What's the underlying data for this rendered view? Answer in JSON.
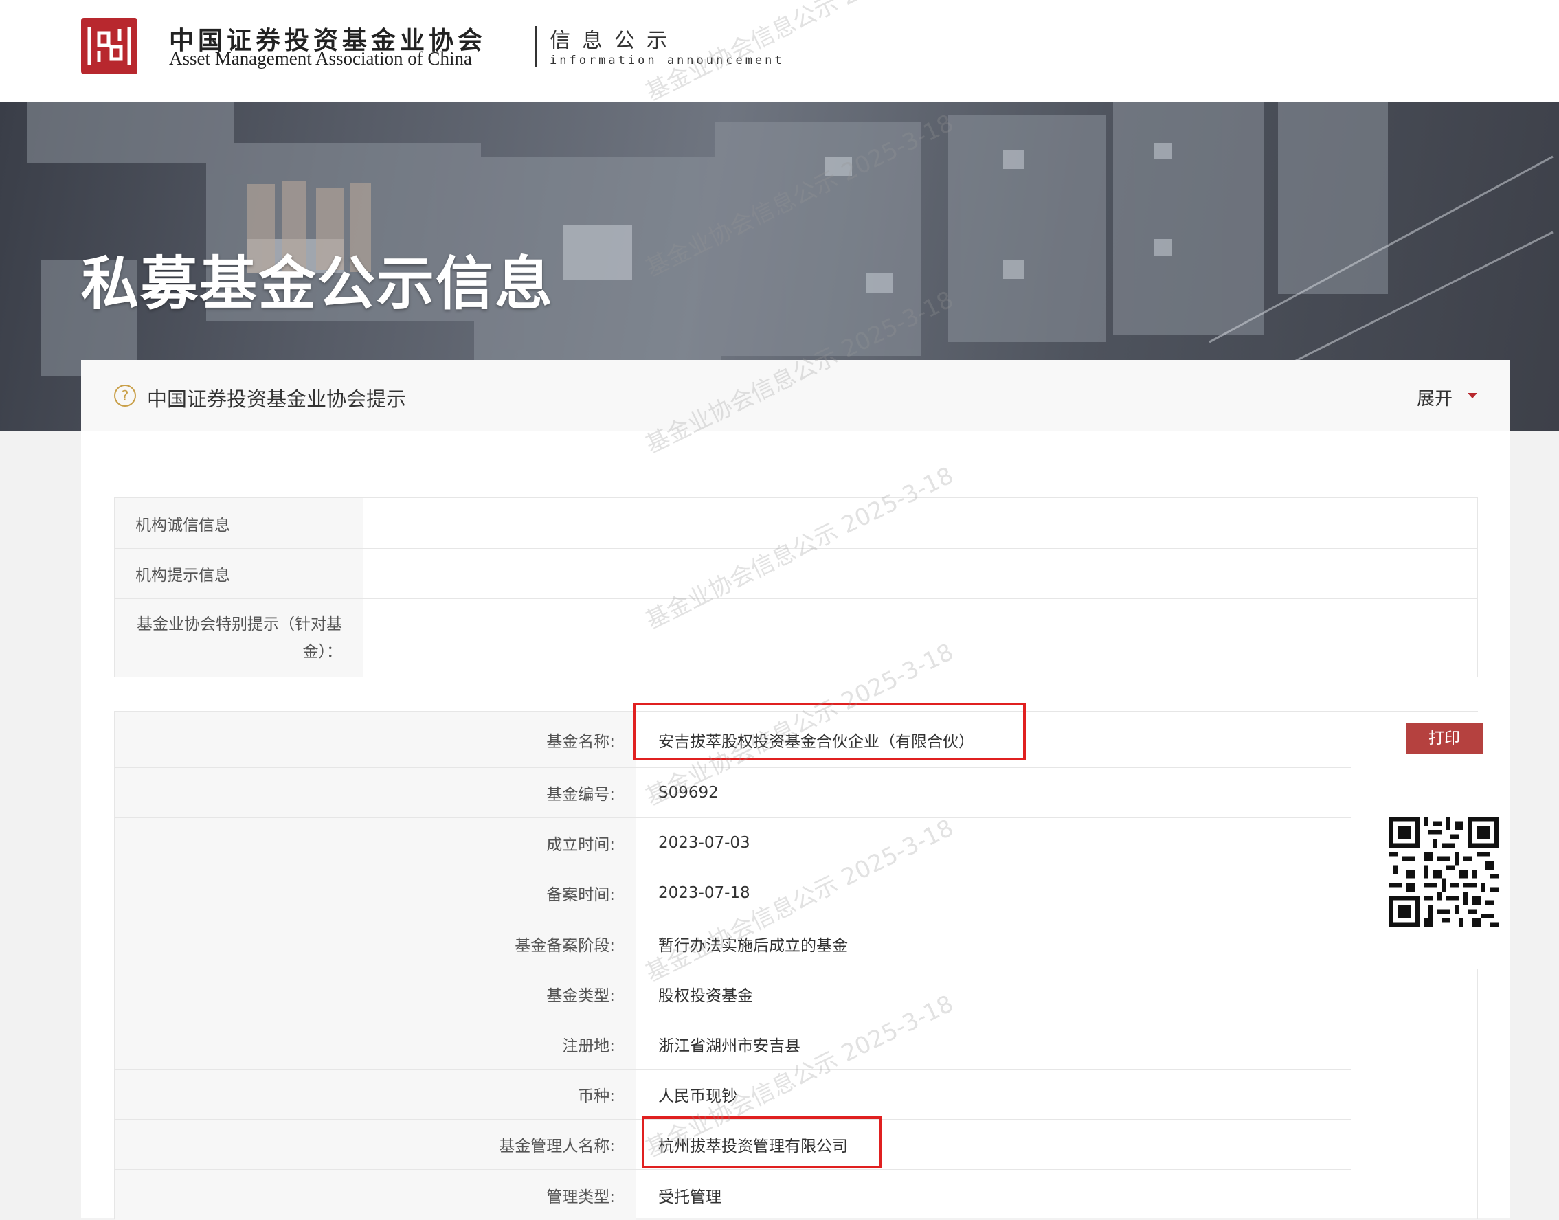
{
  "header": {
    "org_name_cn": "中国证券投资基金业协会",
    "org_name_en": "Asset Management Association of China",
    "section_cn": "信息公示",
    "section_en": "information announcement"
  },
  "banner": {
    "title": "私募基金公示信息"
  },
  "notice": {
    "text": "中国证券投资基金业协会提示",
    "expand_label": "展开"
  },
  "credit_table": {
    "rows": [
      {
        "label": "机构诚信信息",
        "value": ""
      },
      {
        "label": "机构提示信息",
        "value": ""
      },
      {
        "label": "基金业协会特别提示（针对基金）：",
        "value": ""
      }
    ]
  },
  "fund": {
    "print_label": "打印",
    "rows": [
      {
        "label": "基金名称:",
        "value": "安吉拔萃股权投资基金合伙企业（有限合伙）"
      },
      {
        "label": "基金编号:",
        "value": "S09692"
      },
      {
        "label": "成立时间:",
        "value": "2023-07-03"
      },
      {
        "label": "备案时间:",
        "value": "2023-07-18"
      },
      {
        "label": "基金备案阶段:",
        "value": "暂行办法实施后成立的基金"
      },
      {
        "label": "基金类型:",
        "value": "股权投资基金"
      },
      {
        "label": "注册地:",
        "value": "浙江省湖州市安吉县"
      },
      {
        "label": "币种:",
        "value": "人民币现钞"
      },
      {
        "label": "基金管理人名称:",
        "value": "杭州拔萃投资管理有限公司"
      },
      {
        "label": "管理类型:",
        "value": "受托管理"
      }
    ]
  },
  "watermark": {
    "text": "基金业协会信息公示 2025-3-18"
  },
  "colors": {
    "brand_red": "#b8282e",
    "print_button": "#b5413f",
    "highlight_box": "#e02020",
    "notice_icon": "#c9a04a"
  },
  "icons": {
    "notice": "question-circle-icon",
    "expand": "caret-down-icon"
  }
}
